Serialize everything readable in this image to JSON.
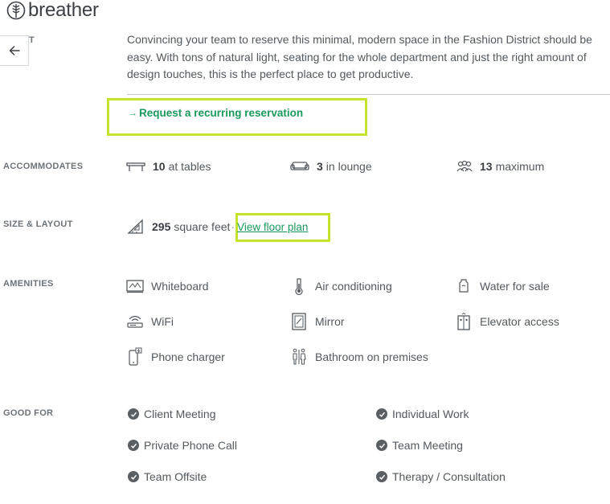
{
  "brand": {
    "name": "breather"
  },
  "about": {
    "label_fragment": "T",
    "description": "Convincing your team to reserve this minimal, modern space in the Fashion District should be easy. With tons of natural light, seating for the whole department and just the right amount of design touches, this is the perfect place to get productive.",
    "recurring_link": "Request a recurring reservation"
  },
  "accommodates": {
    "label": "ACCOMMODATES",
    "tables": {
      "count": "10",
      "text": "at tables",
      "icon": "table-icon"
    },
    "lounge": {
      "count": "3",
      "text": "in lounge",
      "icon": "sofa-icon"
    },
    "maximum": {
      "count": "13",
      "text": "maximum",
      "icon": "people-icon"
    }
  },
  "size_layout": {
    "label": "SIZE & LAYOUT",
    "area": "295",
    "unit": "square feet",
    "separator": "·",
    "floor_plan_link": "View floor plan"
  },
  "amenities": {
    "label": "AMENITIES",
    "items": [
      {
        "label": "Whiteboard",
        "icon": "whiteboard-icon"
      },
      {
        "label": "Air conditioning",
        "icon": "thermometer-icon"
      },
      {
        "label": "Water for sale",
        "icon": "water-bottle-icon"
      },
      {
        "label": "WiFi",
        "icon": "wifi-router-icon"
      },
      {
        "label": "Mirror",
        "icon": "mirror-icon"
      },
      {
        "label": "Elevator access",
        "icon": "elevator-icon"
      },
      {
        "label": "Phone charger",
        "icon": "phone-charger-icon"
      },
      {
        "label": "Bathroom on premises",
        "icon": "bathroom-icon"
      }
    ]
  },
  "good_for": {
    "label": "GOOD FOR",
    "items": [
      "Client Meeting",
      "Individual Work",
      "Private Phone Call",
      "Team Meeting",
      "Team Offsite",
      "Therapy / Consultation"
    ]
  },
  "colors": {
    "accent_green": "#1a9a5c",
    "highlight": "#c6e22b",
    "text": "#53585d"
  }
}
